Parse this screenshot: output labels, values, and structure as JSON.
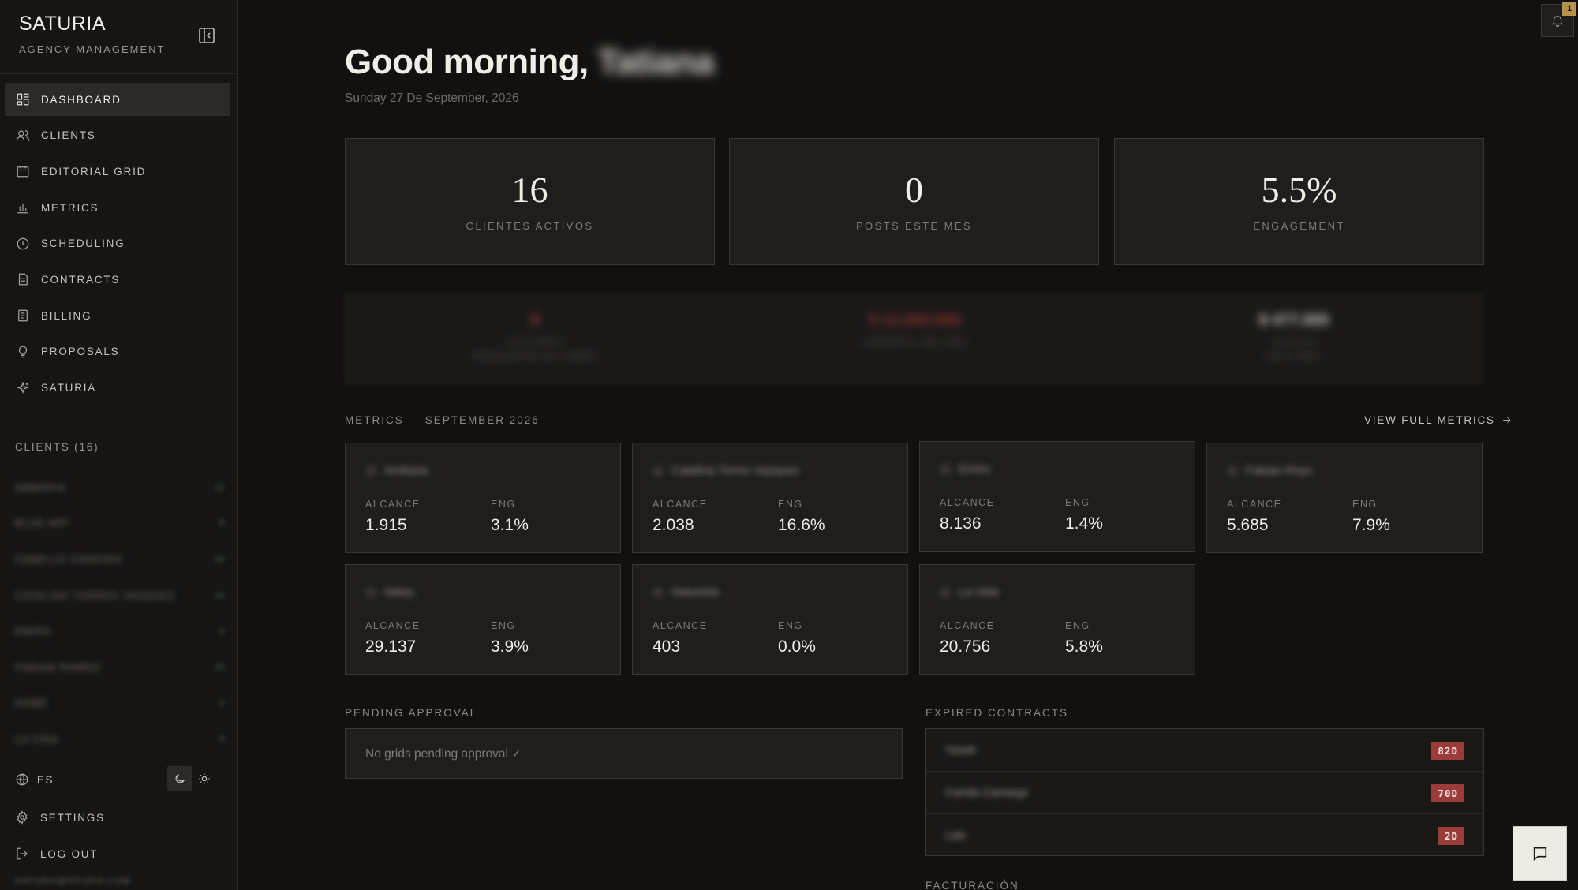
{
  "brand": {
    "name": "SATURIA",
    "subtitle": "AGENCY MANAGEMENT"
  },
  "nav": [
    {
      "label": "DASHBOARD",
      "icon": "dashboard-icon",
      "active": true
    },
    {
      "label": "CLIENTS",
      "icon": "users-icon"
    },
    {
      "label": "EDITORIAL GRID",
      "icon": "calendar-icon"
    },
    {
      "label": "METRICS",
      "icon": "bar-chart-icon"
    },
    {
      "label": "SCHEDULING",
      "icon": "clock-icon"
    },
    {
      "label": "CONTRACTS",
      "icon": "document-icon"
    },
    {
      "label": "BILLING",
      "icon": "receipt-icon"
    },
    {
      "label": "PROPOSALS",
      "icon": "lightbulb-icon"
    },
    {
      "label": "SATURIA",
      "icon": "sparkle-icon"
    }
  ],
  "clients_header": "CLIENTS (16)",
  "clients_list": [
    {
      "name": "AMBARIA",
      "count": "12"
    },
    {
      "name": "BLUE ART",
      "count": "8"
    },
    {
      "name": "CABELLO CANDIDO",
      "count": "10"
    },
    {
      "name": "CATALINA TORRES VAZQUEZ",
      "count": "14"
    },
    {
      "name": "EMIRA",
      "count": "6"
    },
    {
      "name": "FABIAN ROMEO",
      "count": "10"
    },
    {
      "name": "HOME",
      "count": "4"
    },
    {
      "name": "LA VIDA",
      "count": "9"
    }
  ],
  "bottom": {
    "lang": "ES",
    "settings": "SETTINGS",
    "logout": "LOG OUT",
    "footer": "SATURIA@STUDIO.COM"
  },
  "header": {
    "greeting": "Good morning,",
    "user_name": "Tatiana",
    "date": "Sunday 27 De September, 2026"
  },
  "stats": [
    {
      "value": "16",
      "label": "CLIENTES ACTIVOS"
    },
    {
      "value": "0",
      "label": "POSTS ESTE MES"
    },
    {
      "value": "5.5%",
      "label": "ENGAGEMENT"
    }
  ],
  "hidden_summary": [
    {
      "a": "0",
      "b": "FACTURAS",
      "c": "PENDIENTES DE COBRO"
    },
    {
      "a": "$ 12.000.000",
      "b": "INGRESOS DEL MES",
      "c": ""
    },
    {
      "a": "$ 477.000",
      "b": "GASTOS",
      "c": "ESTE MES"
    }
  ],
  "metrics_section": {
    "title": "METRICS — SEPTEMBER 2026",
    "view_all": "VIEW FULL METRICS",
    "reach_label": "ALCANCE",
    "eng_label": "ENG",
    "cards": [
      {
        "name": "Ambaria",
        "reach": "1.915",
        "eng": "3.1%"
      },
      {
        "name": "Catalina Torres Vazquez",
        "reach": "2.038",
        "eng": "16.6%"
      },
      {
        "name": "Emira",
        "reach": "8.136",
        "eng": "1.4%"
      },
      {
        "name": "Fabian Roys",
        "reach": "5.685",
        "eng": "7.9%"
      },
      {
        "name": "Nalsy",
        "reach": "29.137",
        "eng": "3.9%"
      },
      {
        "name": "Naturista",
        "reach": "403",
        "eng": "0.0%"
      },
      {
        "name": "La Vida",
        "reach": "20.756",
        "eng": "5.8%"
      }
    ]
  },
  "pending": {
    "title": "PENDING APPROVAL",
    "empty_text": "No grids pending approval ✓"
  },
  "contracts": {
    "title": "EXPIRED CONTRACTS",
    "rows": [
      {
        "name": "Yanek",
        "badge": "82D"
      },
      {
        "name": "Camila Camargo",
        "badge": "70D"
      },
      {
        "name": "Lalo",
        "badge": "2D"
      }
    ]
  },
  "billing_title": "FACTURACIÓN",
  "notifications": {
    "count": "1"
  },
  "colors": {
    "accent_badge": "#9b3c3a",
    "notification_badge": "#b8924a",
    "background": "#121110",
    "card": "#1f1e1c"
  }
}
